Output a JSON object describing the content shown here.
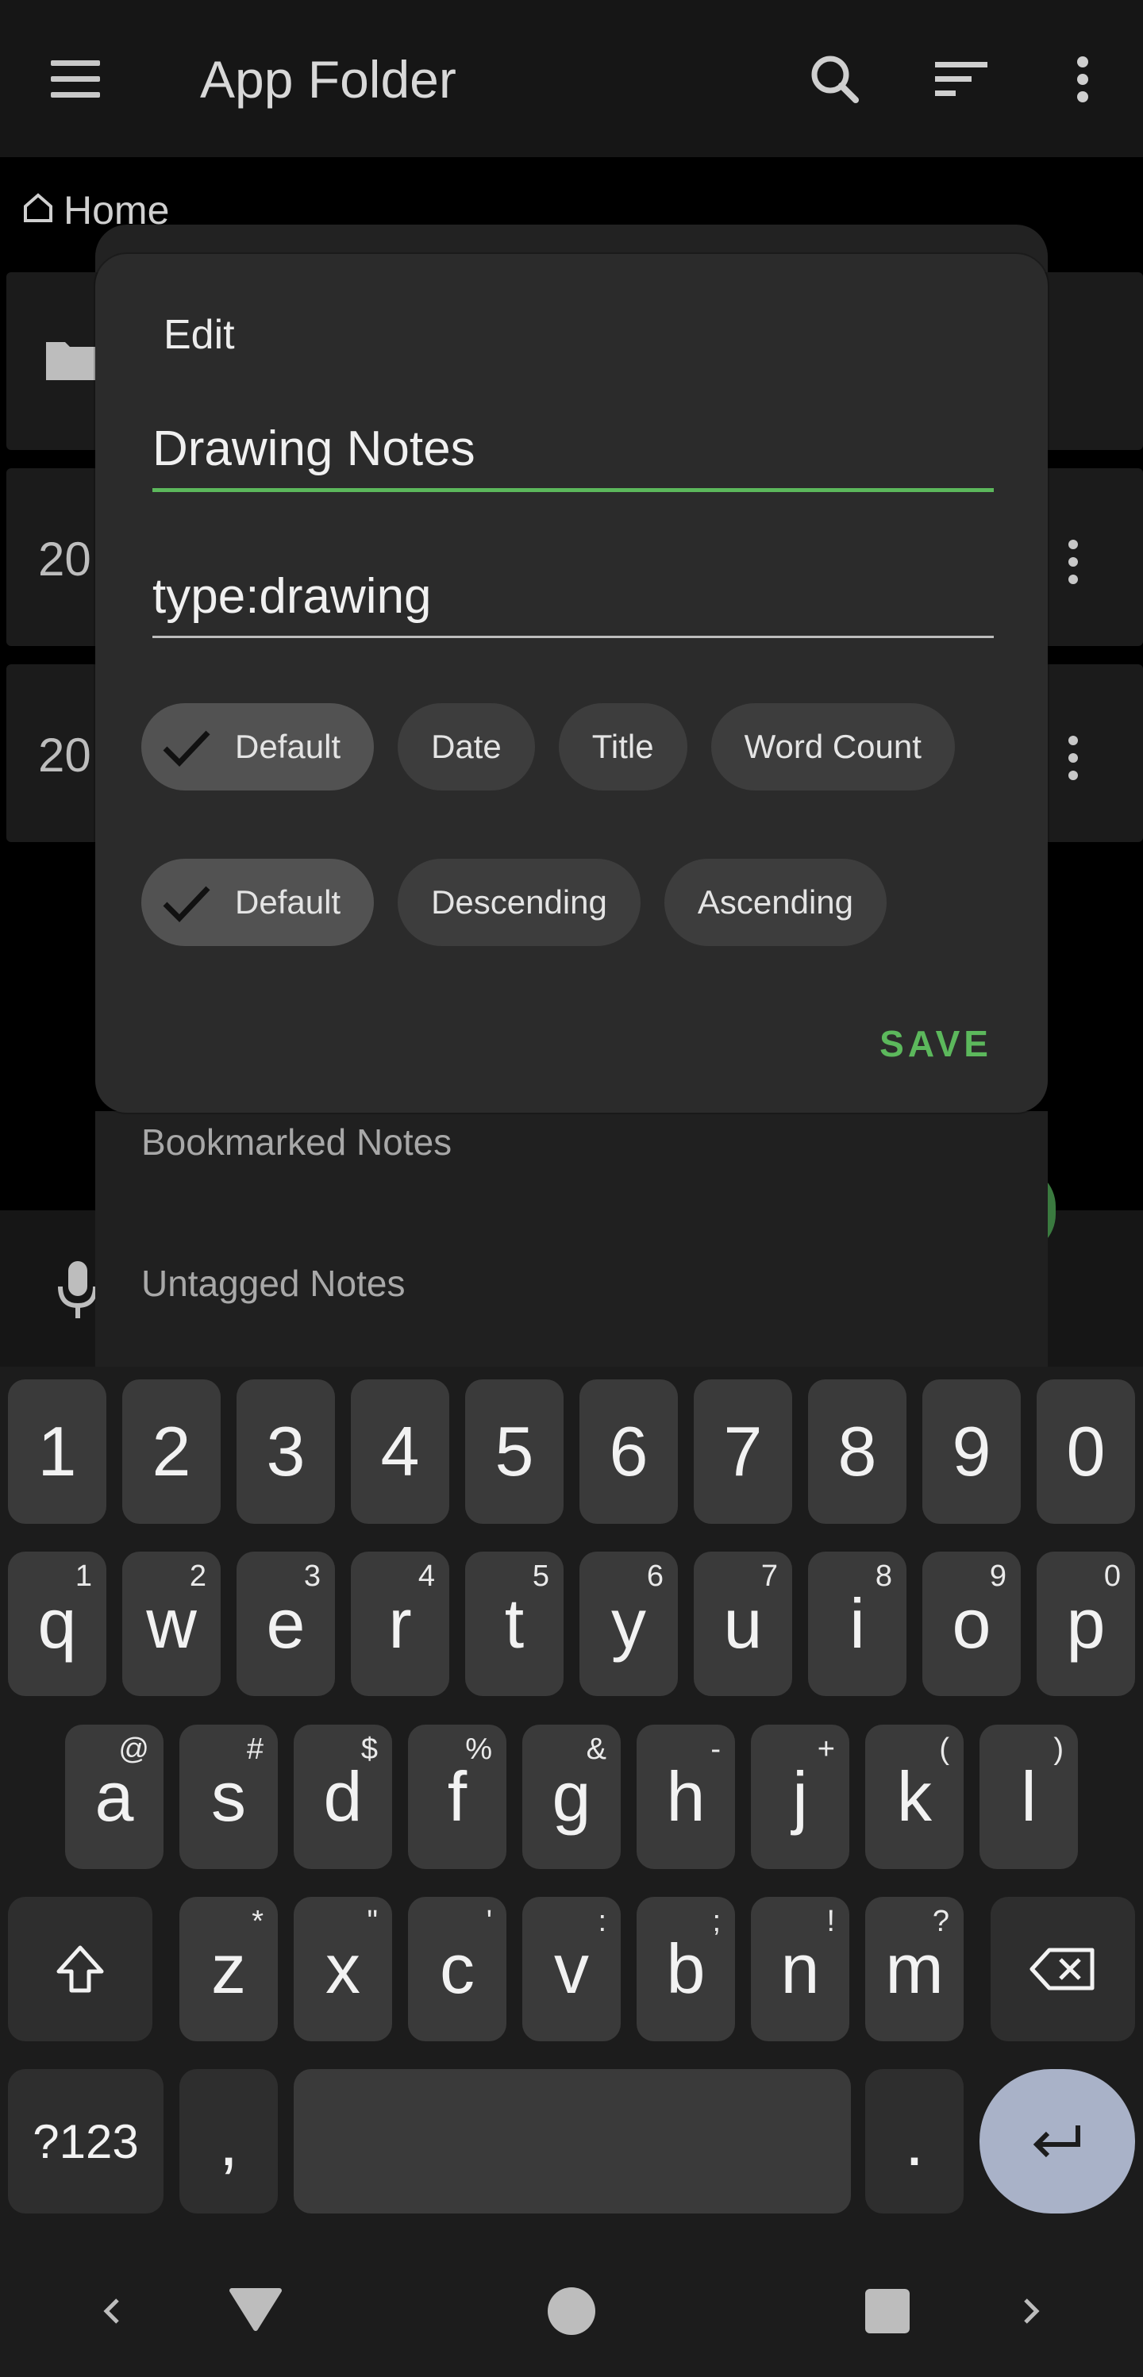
{
  "appbar": {
    "title": "App Folder",
    "icons": [
      "menu-icon",
      "search-icon",
      "sort-icon",
      "more-vert-icon"
    ]
  },
  "breadcrumb": {
    "label": "Home",
    "icon": "home-icon"
  },
  "background_list": [
    {
      "text": ""
    },
    {
      "text": "20"
    },
    {
      "text": "20"
    }
  ],
  "background_menu": {
    "items": [
      "Bookmarked Notes",
      "Untagged Notes"
    ]
  },
  "dialog": {
    "title": "Edit",
    "name_value": "Drawing Notes",
    "tag_value": "type:drawing",
    "sort_by": [
      {
        "label": "Default",
        "selected": true
      },
      {
        "label": "Date",
        "selected": false
      },
      {
        "label": "Title",
        "selected": false
      },
      {
        "label": "Word Count",
        "selected": false
      }
    ],
    "sort_order": [
      {
        "label": "Default",
        "selected": true
      },
      {
        "label": "Descending",
        "selected": false
      },
      {
        "label": "Ascending",
        "selected": false
      }
    ],
    "save_label": "SAVE",
    "accent_color": "#5cb85c"
  },
  "keyboard": {
    "row_numbers": [
      "1",
      "2",
      "3",
      "4",
      "5",
      "6",
      "7",
      "8",
      "9",
      "0"
    ],
    "row1": [
      [
        "q",
        "1"
      ],
      [
        "w",
        "2"
      ],
      [
        "e",
        "3"
      ],
      [
        "r",
        "4"
      ],
      [
        "t",
        "5"
      ],
      [
        "y",
        "6"
      ],
      [
        "u",
        "7"
      ],
      [
        "i",
        "8"
      ],
      [
        "o",
        "9"
      ],
      [
        "p",
        "0"
      ]
    ],
    "row2": [
      [
        "a",
        "@"
      ],
      [
        "s",
        "#"
      ],
      [
        "d",
        "$"
      ],
      [
        "f",
        "%"
      ],
      [
        "g",
        "&"
      ],
      [
        "h",
        "-"
      ],
      [
        "j",
        "+"
      ],
      [
        "k",
        "("
      ],
      [
        "l",
        ")"
      ]
    ],
    "row3": [
      [
        "z",
        "*"
      ],
      [
        "x",
        "\""
      ],
      [
        "c",
        "'"
      ],
      [
        "v",
        ":"
      ],
      [
        "b",
        ";"
      ],
      [
        "n",
        "!"
      ],
      [
        "m",
        "?"
      ]
    ],
    "symbols_label": "?123",
    "comma": ",",
    "period": ".",
    "shift_icon": "shift-icon",
    "backspace_icon": "backspace-icon",
    "enter_icon": "enter-icon"
  },
  "navbar": {
    "icons": [
      "nav-left-icon",
      "back-triangle-icon",
      "home-circle-icon",
      "recents-square-icon",
      "nav-right-icon"
    ]
  }
}
